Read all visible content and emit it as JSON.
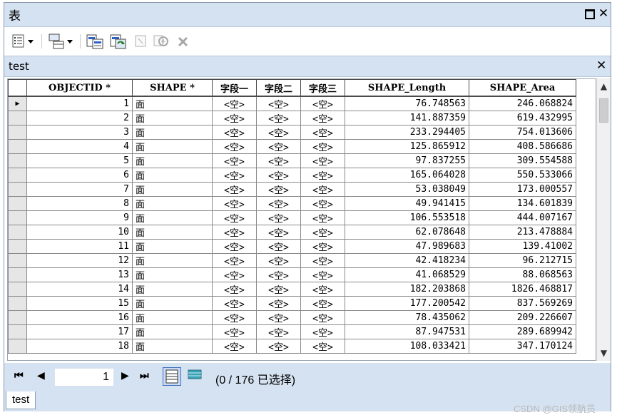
{
  "window": {
    "title": "表",
    "close_icon": "close-icon",
    "maximize_icon": "maximize-icon"
  },
  "toolbar": {
    "icons": [
      "table-options-icon",
      "related-tables-icon",
      "select-by-attributes-icon",
      "switch-selection-icon",
      "clear-selection-icon",
      "zoom-to-selected-icon",
      "delete-selected-icon"
    ]
  },
  "table_tab": {
    "title": "test"
  },
  "grid": {
    "columns": [
      "OBJECTID *",
      "SHAPE *",
      "字段一",
      "字段二",
      "字段三",
      "SHAPE_Length",
      "SHAPE_Area"
    ],
    "rows": [
      [
        "1",
        "面",
        "<空>",
        "<空>",
        "<空>",
        "76.748563",
        "246.068824"
      ],
      [
        "2",
        "面",
        "<空>",
        "<空>",
        "<空>",
        "141.887359",
        "619.432995"
      ],
      [
        "3",
        "面",
        "<空>",
        "<空>",
        "<空>",
        "233.294405",
        "754.013606"
      ],
      [
        "4",
        "面",
        "<空>",
        "<空>",
        "<空>",
        "125.865912",
        "408.586686"
      ],
      [
        "5",
        "面",
        "<空>",
        "<空>",
        "<空>",
        "97.837255",
        "309.554588"
      ],
      [
        "6",
        "面",
        "<空>",
        "<空>",
        "<空>",
        "165.064028",
        "550.533066"
      ],
      [
        "7",
        "面",
        "<空>",
        "<空>",
        "<空>",
        "53.038049",
        "173.000557"
      ],
      [
        "8",
        "面",
        "<空>",
        "<空>",
        "<空>",
        "49.941415",
        "134.601839"
      ],
      [
        "9",
        "面",
        "<空>",
        "<空>",
        "<空>",
        "106.553518",
        "444.007167"
      ],
      [
        "10",
        "面",
        "<空>",
        "<空>",
        "<空>",
        "62.078648",
        "213.478884"
      ],
      [
        "11",
        "面",
        "<空>",
        "<空>",
        "<空>",
        "47.989683",
        "139.41002"
      ],
      [
        "12",
        "面",
        "<空>",
        "<空>",
        "<空>",
        "42.418234",
        "96.212715"
      ],
      [
        "13",
        "面",
        "<空>",
        "<空>",
        "<空>",
        "41.068529",
        "88.068563"
      ],
      [
        "14",
        "面",
        "<空>",
        "<空>",
        "<空>",
        "182.203868",
        "1826.468817"
      ],
      [
        "15",
        "面",
        "<空>",
        "<空>",
        "<空>",
        "177.200542",
        "837.569269"
      ],
      [
        "16",
        "面",
        "<空>",
        "<空>",
        "<空>",
        "78.435062",
        "209.226607"
      ],
      [
        "17",
        "面",
        "<空>",
        "<空>",
        "<空>",
        "87.947531",
        "289.689942"
      ],
      [
        "18",
        "面",
        "<空>",
        "<空>",
        "<空>",
        "108.033421",
        "347.170124"
      ]
    ]
  },
  "navigation": {
    "current_record": "1",
    "status": "(0 / 176 已选择)"
  },
  "bottom_tab": {
    "label": "test"
  },
  "watermark": "CSDN @GIS领航员",
  "colors": {
    "chrome": "#d5e2f1",
    "selected_view": "#c9daf2"
  }
}
